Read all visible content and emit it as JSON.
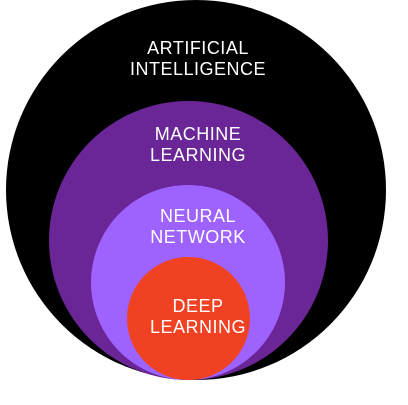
{
  "diagram": {
    "layers": [
      {
        "key": "ai",
        "line1": "ARTIFICIAL",
        "line2": "INTELLIGENCE",
        "fill": "#000000",
        "text_color": "#ffffff"
      },
      {
        "key": "ml",
        "line1": "MACHINE",
        "line2": "LEARNING",
        "fill": "#6a2596",
        "text_color": "#ffffff"
      },
      {
        "key": "nn",
        "line1": "NEURAL",
        "line2": "NETWORK",
        "fill": "#9e62ff",
        "text_color": "#ffffff"
      },
      {
        "key": "dl",
        "line1": "DEEP",
        "line2": "LEARNING",
        "fill": "#f04223",
        "text_color": "#ffffff"
      }
    ]
  }
}
